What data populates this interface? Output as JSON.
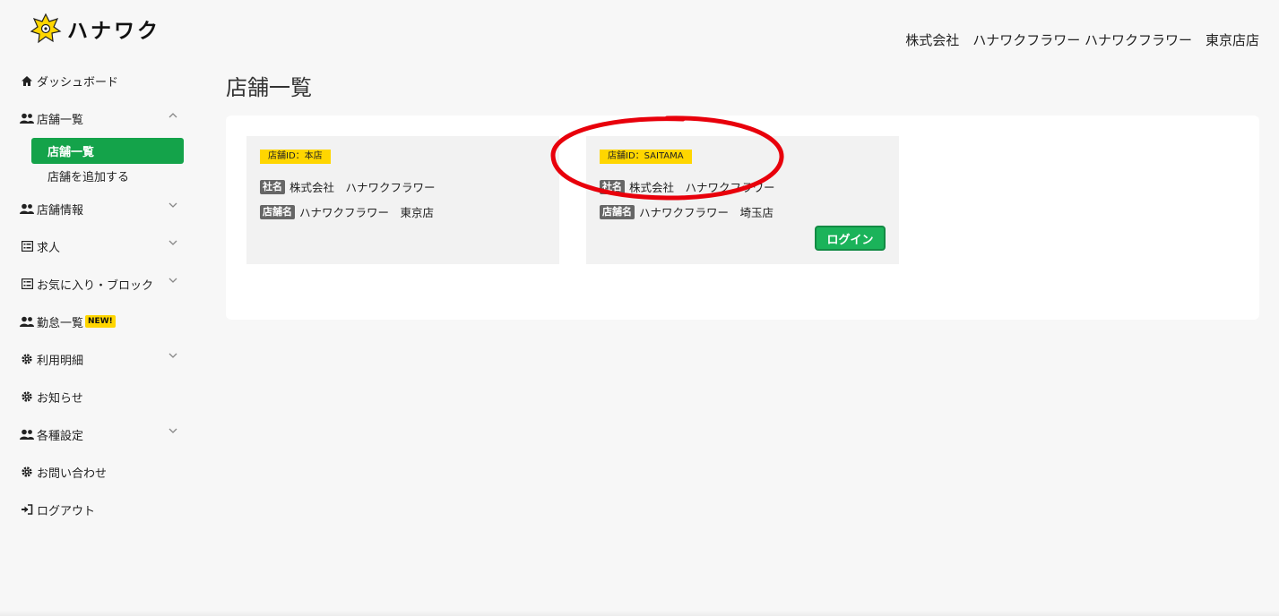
{
  "brand": {
    "name": "ハナワク",
    "color": "#ffd600"
  },
  "header": {
    "company": "株式会社　ハナワクフラワー ハナワクフラワー　東京店店"
  },
  "sidebar": {
    "items": [
      {
        "label": "ダッシュボード",
        "icon": "home-icon"
      },
      {
        "label": "店舗一覧",
        "icon": "users-icon",
        "expanded": true
      },
      {
        "label": "店舗情報",
        "icon": "users-icon"
      },
      {
        "label": "求人",
        "icon": "list-icon"
      },
      {
        "label": "お気に入り・ブロック",
        "icon": "list-icon"
      },
      {
        "label": "勤怠一覧",
        "icon": "users-icon",
        "badge": "NEW!"
      },
      {
        "label": "利用明細",
        "icon": "gear-icon"
      },
      {
        "label": "お知らせ",
        "icon": "gear-icon"
      },
      {
        "label": "各種設定",
        "icon": "users-icon"
      },
      {
        "label": "お問い合わせ",
        "icon": "gear-icon"
      },
      {
        "label": "ログアウト",
        "icon": "logout-icon"
      }
    ],
    "sub_items": [
      {
        "label": "店舗一覧",
        "active": true
      },
      {
        "label": "店舗を追加する"
      }
    ],
    "active_color": "#14a34a"
  },
  "main": {
    "title": "店舗一覧",
    "cards": [
      {
        "id_label": "店舗ID：本店",
        "company_tag": "社名",
        "company": "株式会社　ハナワクフラワー",
        "store_tag": "店舗名",
        "store": "ハナワクフラワー　東京店"
      },
      {
        "id_label": "店舗ID：SAITAMA",
        "company_tag": "社名",
        "company": "株式会社　ハナワクフラワー",
        "store_tag": "店舗名",
        "store": "ハナワクフラワー　埼玉店",
        "button": "ログイン"
      }
    ]
  },
  "annotation_color": "#e8000b"
}
